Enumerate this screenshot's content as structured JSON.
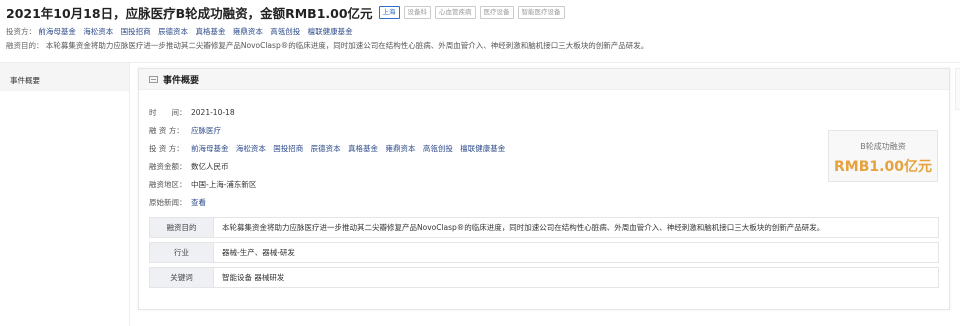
{
  "header": {
    "title": "2021年10月18日，应脉医疗B轮成功融资，金额RMB1.00亿元",
    "tags": [
      "上海",
      "设备科",
      "心血管疾病",
      "医疗设备",
      "智能医疗设备"
    ],
    "investors_label": "投资方：",
    "investors": [
      "前海母基金",
      "海松资本",
      "国投招商",
      "辰德资本",
      "真格基金",
      "雍鼎资本",
      "高瓴创投",
      "檀联健康基金"
    ],
    "purpose_label": "融资目的：",
    "purpose": "本轮募集资金将助力应脉医疗进一步推动其二尖瓣修复产品NovoClasp®的临床进度，同时加速公司在结构性心脏病、外周血管介入、神经刺激和脑机接口三大板块的创新产品研发。"
  },
  "sidebar": {
    "items": [
      {
        "label": "事件概要"
      }
    ]
  },
  "card": {
    "title": "事件概要",
    "time_label": "时　　间：",
    "time": "2021-10-18",
    "financing_party_label": "融 资 方：",
    "financing_party": "应脉医疗",
    "investor_label": "投 资 方：",
    "investors": [
      "前海母基金",
      "海松资本",
      "国投招商",
      "辰德资本",
      "真格基金",
      "雍鼎资本",
      "高瓴创投",
      "檀联健康基金"
    ],
    "amount_label": "融资金额：",
    "amount_text": "数亿人民币",
    "region_label": "融资地区：",
    "region": "中国-上海-浦东新区",
    "news_label": "原始新闻：",
    "news_link": "查看",
    "round_label": "B轮成功融资",
    "round_amount": "RMB1.00亿元",
    "table": [
      {
        "key": "融资目的",
        "value": "本轮募集资金将助力应脉医疗进一步推动其二尖瓣修复产品NovoClasp®的临床进度，同时加速公司在结构性心脏病、外周血管介入、神经刺激和脑机接口三大板块的创新产品研发。"
      },
      {
        "key": "行业",
        "value": "器械-生产、器械-研发"
      },
      {
        "key": "关键词",
        "value": "智能设备 器械研发"
      }
    ]
  },
  "colors": {
    "link": "#2d4a8a",
    "amount": "#e6a23c",
    "tag_primary": "#2e6fc9"
  }
}
